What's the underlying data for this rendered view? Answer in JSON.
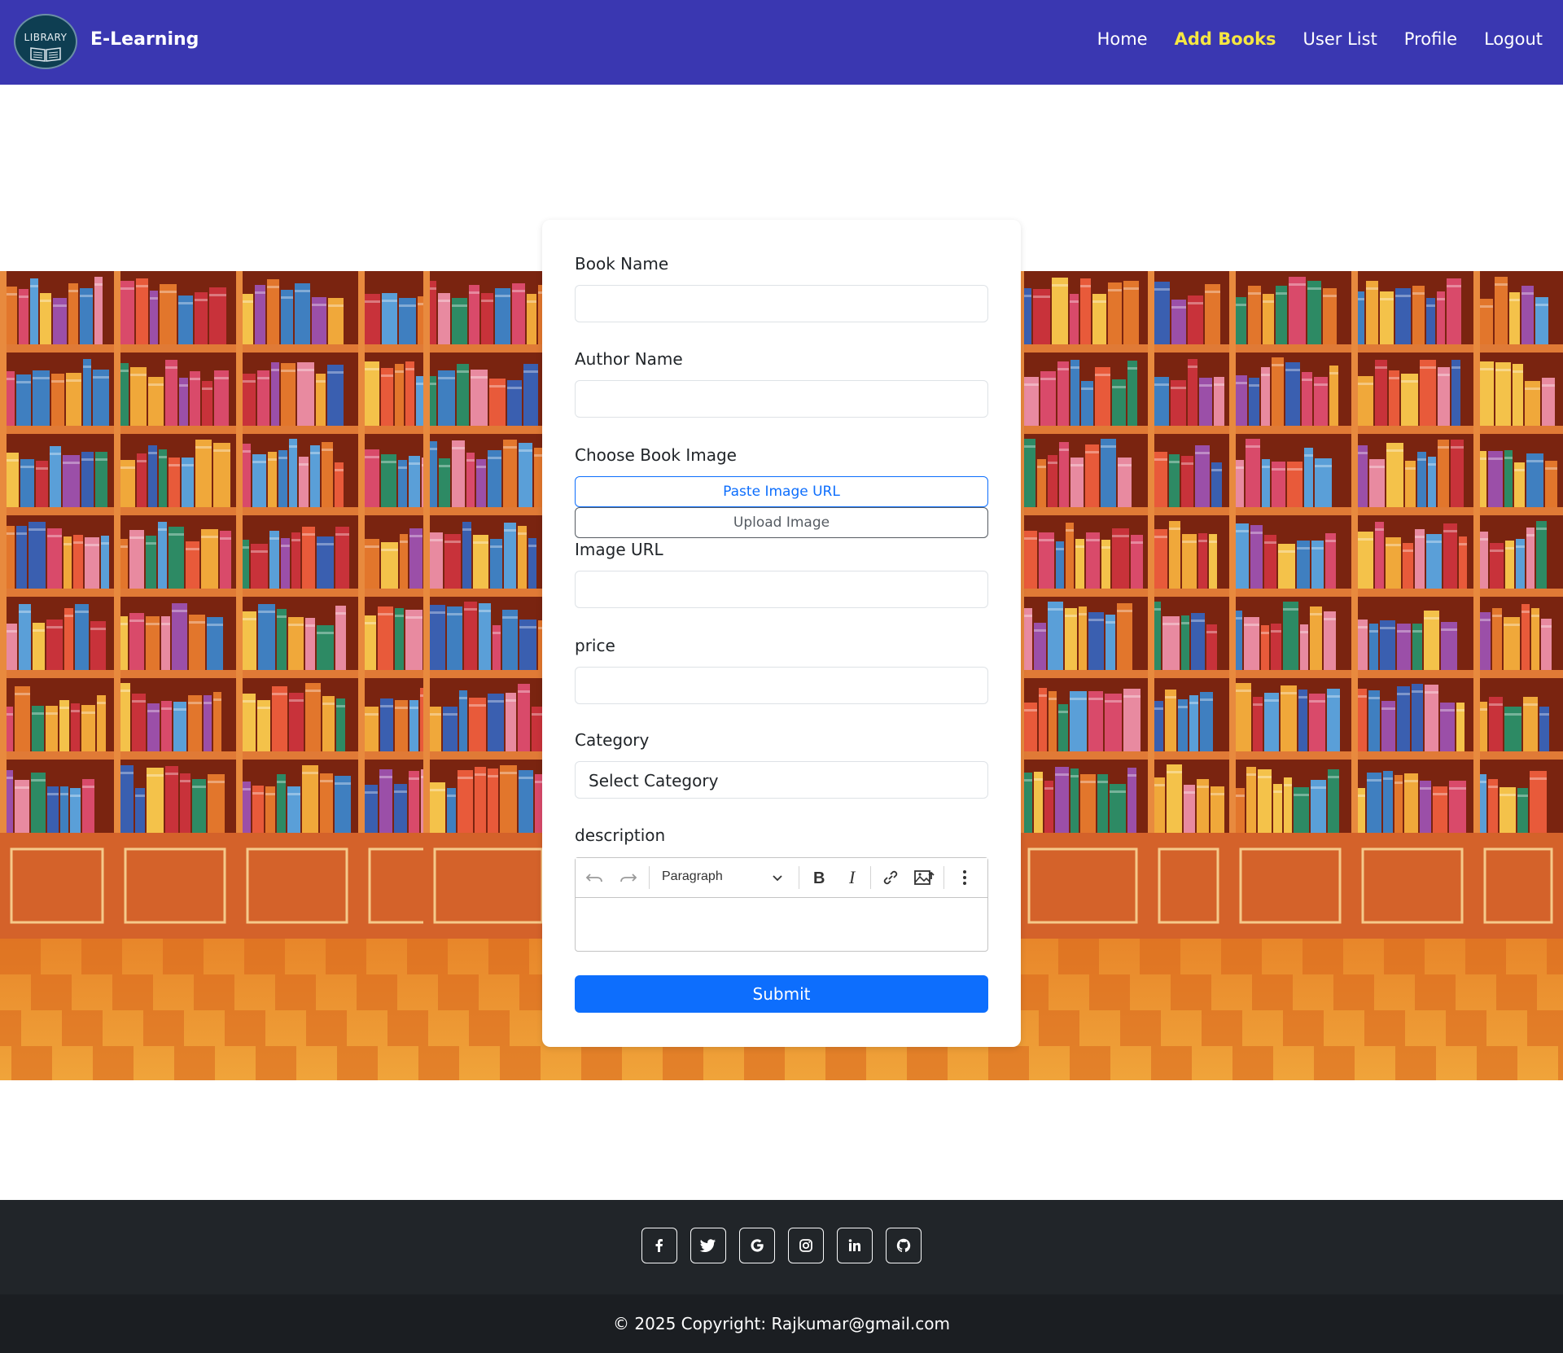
{
  "navbar": {
    "logo_text": "LIBRARY",
    "brand": "E-Learning",
    "links": [
      {
        "label": "Home",
        "active": false
      },
      {
        "label": "Add Books",
        "active": true
      },
      {
        "label": "User List",
        "active": false
      },
      {
        "label": "Profile",
        "active": false
      },
      {
        "label": "Logout",
        "active": false
      }
    ],
    "bg_color": "#3a37b1",
    "active_color": "#f5e642"
  },
  "form": {
    "book_name_label": "Book Name",
    "book_name_value": "",
    "author_name_label": "Author Name",
    "author_name_value": "",
    "choose_image_label": "Choose Book Image",
    "paste_url_button": "Paste Image URL",
    "upload_image_button": "Upload Image",
    "image_url_label": "Image URL",
    "image_url_value": "",
    "price_label": "price",
    "price_value": "",
    "category_label": "Category",
    "category_selected": "Select Category",
    "description_label": "description",
    "editor": {
      "block_format": "Paragraph",
      "tools": [
        "undo-icon",
        "redo-icon",
        "bold-icon",
        "italic-icon",
        "link-icon",
        "insert-image-icon",
        "more-icon"
      ],
      "content": ""
    },
    "submit_label": "Submit",
    "submit_color": "#0d6efd"
  },
  "footer": {
    "social": [
      "facebook-icon",
      "twitter-icon",
      "google-icon",
      "instagram-icon",
      "linkedin-icon",
      "github-icon"
    ],
    "copyright": "© 2025 Copyright: Rajkumar@gmail.com"
  }
}
